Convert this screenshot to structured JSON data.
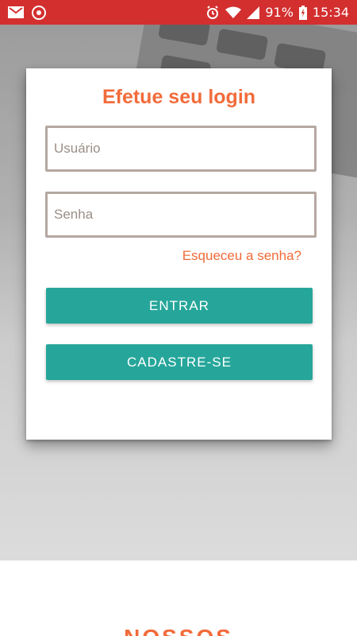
{
  "status_bar": {
    "battery": "91%",
    "time": "15:34",
    "icons": [
      "mail-icon",
      "record-icon",
      "alarm-icon",
      "wifi-icon",
      "signal-icon",
      "battery-icon"
    ],
    "color": "#d32f2f"
  },
  "login": {
    "title": "Efetue seu login",
    "username_placeholder": "Usuário",
    "password_placeholder": "Senha",
    "forgot_password": "Esqueceu a senha?",
    "login_button": "ENTRAR",
    "signup_button": "CADASTRE-SE"
  },
  "section": {
    "title": "NOSSOS"
  },
  "colors": {
    "accent": "#f26b3a",
    "button": "#26a69a",
    "input_border": "#b5a8a1"
  }
}
